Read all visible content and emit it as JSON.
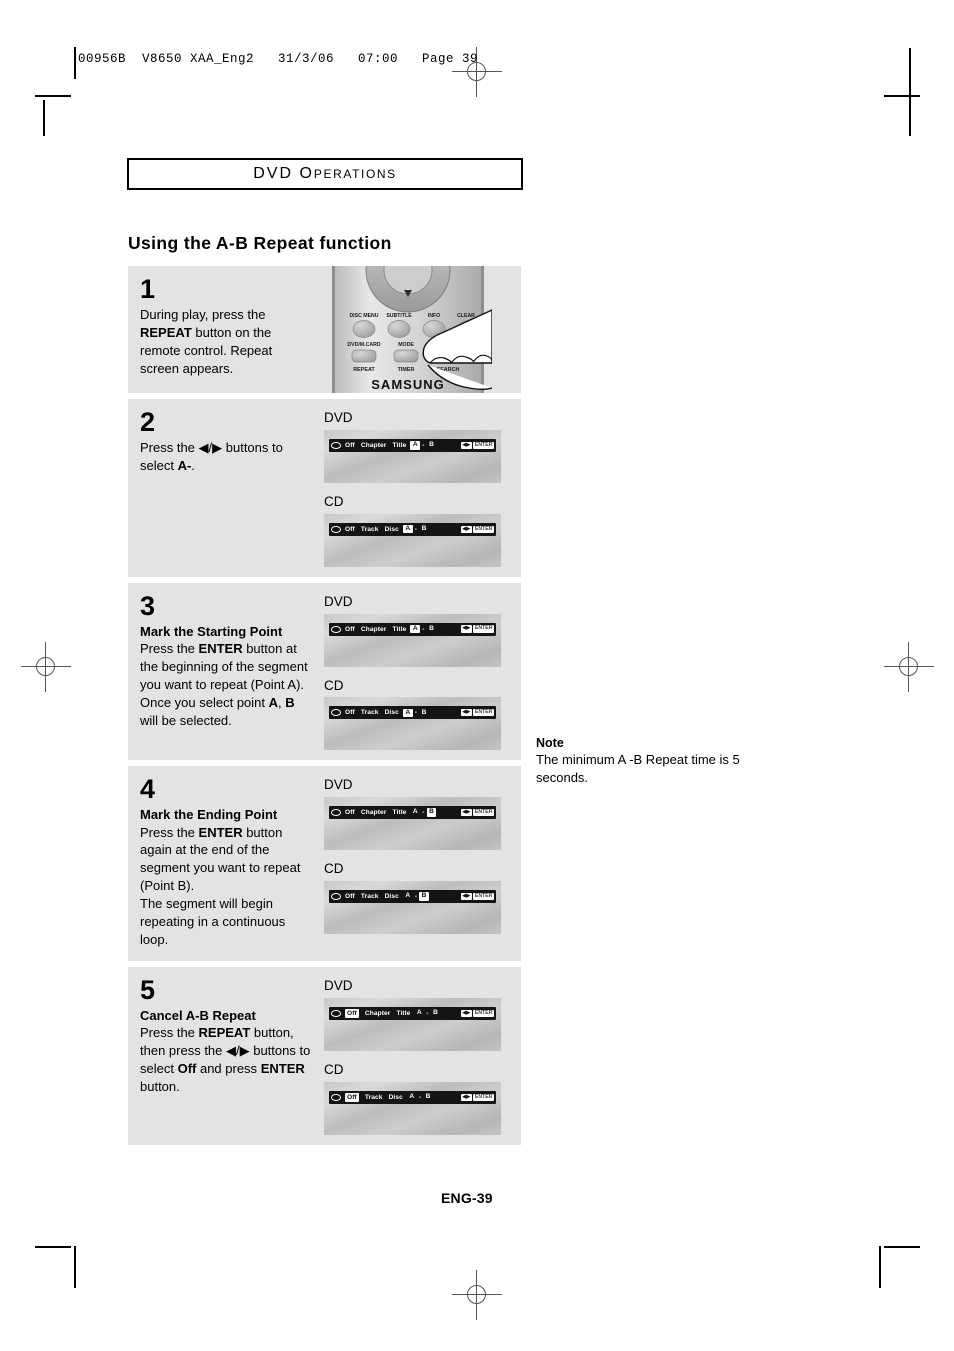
{
  "print_header": {
    "slug": "00956B  V8650 XAA_Eng2   31/3/06   07:00   Page 39"
  },
  "chapter_banner": {
    "word_main": "DVD",
    "word_rest_cap": "O",
    "word_rest_small": "PERATIONS"
  },
  "section": {
    "title": "Using the A-B Repeat function"
  },
  "steps": [
    {
      "number": "1",
      "heading": "",
      "body_html": "During play, press the <b>REPEAT</b> button on the remote control. Repeat screen appears.",
      "visual": "remote"
    },
    {
      "number": "2",
      "heading": "",
      "body_html": "Press the ◀/▶ buttons to select <b>A-</b>.",
      "visual": "osd",
      "screens": [
        {
          "label": "DVD",
          "mode_label": "Off",
          "mode_highlighted": false,
          "items": [
            "Chapter",
            "Title"
          ],
          "point_a": "A",
          "point_b": "B",
          "a_selected": true,
          "b_selected": false,
          "nav_key": "◀▶",
          "enter_key": "ENTER"
        },
        {
          "label": "CD",
          "mode_label": "Off",
          "mode_highlighted": false,
          "items": [
            "Track",
            "Disc"
          ],
          "point_a": "A",
          "point_b": "B",
          "a_selected": true,
          "b_selected": false,
          "nav_key": "◀▶",
          "enter_key": "ENTER"
        }
      ]
    },
    {
      "number": "3",
      "heading": "Mark the Starting Point",
      "body_html": "Press the <b>ENTER</b> button at the beginning of the segment you want to repeat (Point A). Once you select point <b>A</b>, <b>B</b> will be selected.",
      "visual": "osd",
      "screens": [
        {
          "label": "DVD",
          "mode_label": "Off",
          "mode_highlighted": false,
          "items": [
            "Chapter",
            "Title"
          ],
          "point_a": "A",
          "point_b": "B",
          "a_selected": true,
          "b_selected": false,
          "nav_key": "◀▶",
          "enter_key": "ENTER"
        },
        {
          "label": "CD",
          "mode_label": "Off",
          "mode_highlighted": false,
          "items": [
            "Track",
            "Disc"
          ],
          "point_a": "A",
          "point_b": "B",
          "a_selected": true,
          "b_selected": false,
          "nav_key": "◀▶",
          "enter_key": "ENTER"
        }
      ]
    },
    {
      "number": "4",
      "heading": "Mark the Ending Point",
      "body_html": "Press the <b>ENTER</b> button again at the end of the segment you want to repeat (Point B).<br>The segment will begin repeating in a continuous loop.",
      "visual": "osd",
      "screens": [
        {
          "label": "DVD",
          "mode_label": "Off",
          "mode_highlighted": false,
          "items": [
            "Chapter",
            "Title"
          ],
          "point_a": "A",
          "point_b": "B",
          "a_selected": false,
          "b_selected": true,
          "nav_key": "◀▶",
          "enter_key": "ENTER"
        },
        {
          "label": "CD",
          "mode_label": "Off",
          "mode_highlighted": false,
          "items": [
            "Track",
            "Disc"
          ],
          "point_a": "A",
          "point_b": "B",
          "a_selected": false,
          "b_selected": true,
          "nav_key": "◀▶",
          "enter_key": "ENTER"
        }
      ]
    },
    {
      "number": "5",
      "heading": "Cancel A-B Repeat",
      "body_html": "Press the <b>REPEAT</b> button, then press the ◀/▶ buttons to select <b>Off</b> and press <b>ENTER</b> button.",
      "visual": "osd",
      "screens": [
        {
          "label": "DVD",
          "mode_label": "Off",
          "mode_highlighted": true,
          "items": [
            "Chapter",
            "Title"
          ],
          "point_a": "A",
          "point_b": "B",
          "a_selected": false,
          "b_selected": false,
          "nav_key": "◀▶",
          "enter_key": "ENTER"
        },
        {
          "label": "CD",
          "mode_label": "Off",
          "mode_highlighted": true,
          "items": [
            "Track",
            "Disc"
          ],
          "point_a": "A",
          "point_b": "B",
          "a_selected": false,
          "b_selected": false,
          "nav_key": "◀▶",
          "enter_key": "ENTER"
        }
      ]
    }
  ],
  "remote": {
    "row1": [
      "DISC MENU",
      "SUBTITLE",
      "INFO",
      "CLEAR"
    ],
    "row2": [
      "DVD/M.CARD",
      "MODE"
    ],
    "row3": [
      "REPEAT",
      "TIMER",
      "SEARCH"
    ],
    "brand": "SAMSUNG"
  },
  "note": {
    "title": "Note",
    "text": "The minimum A -B Repeat time is 5 seconds."
  },
  "footer": {
    "folio": "ENG-39"
  }
}
